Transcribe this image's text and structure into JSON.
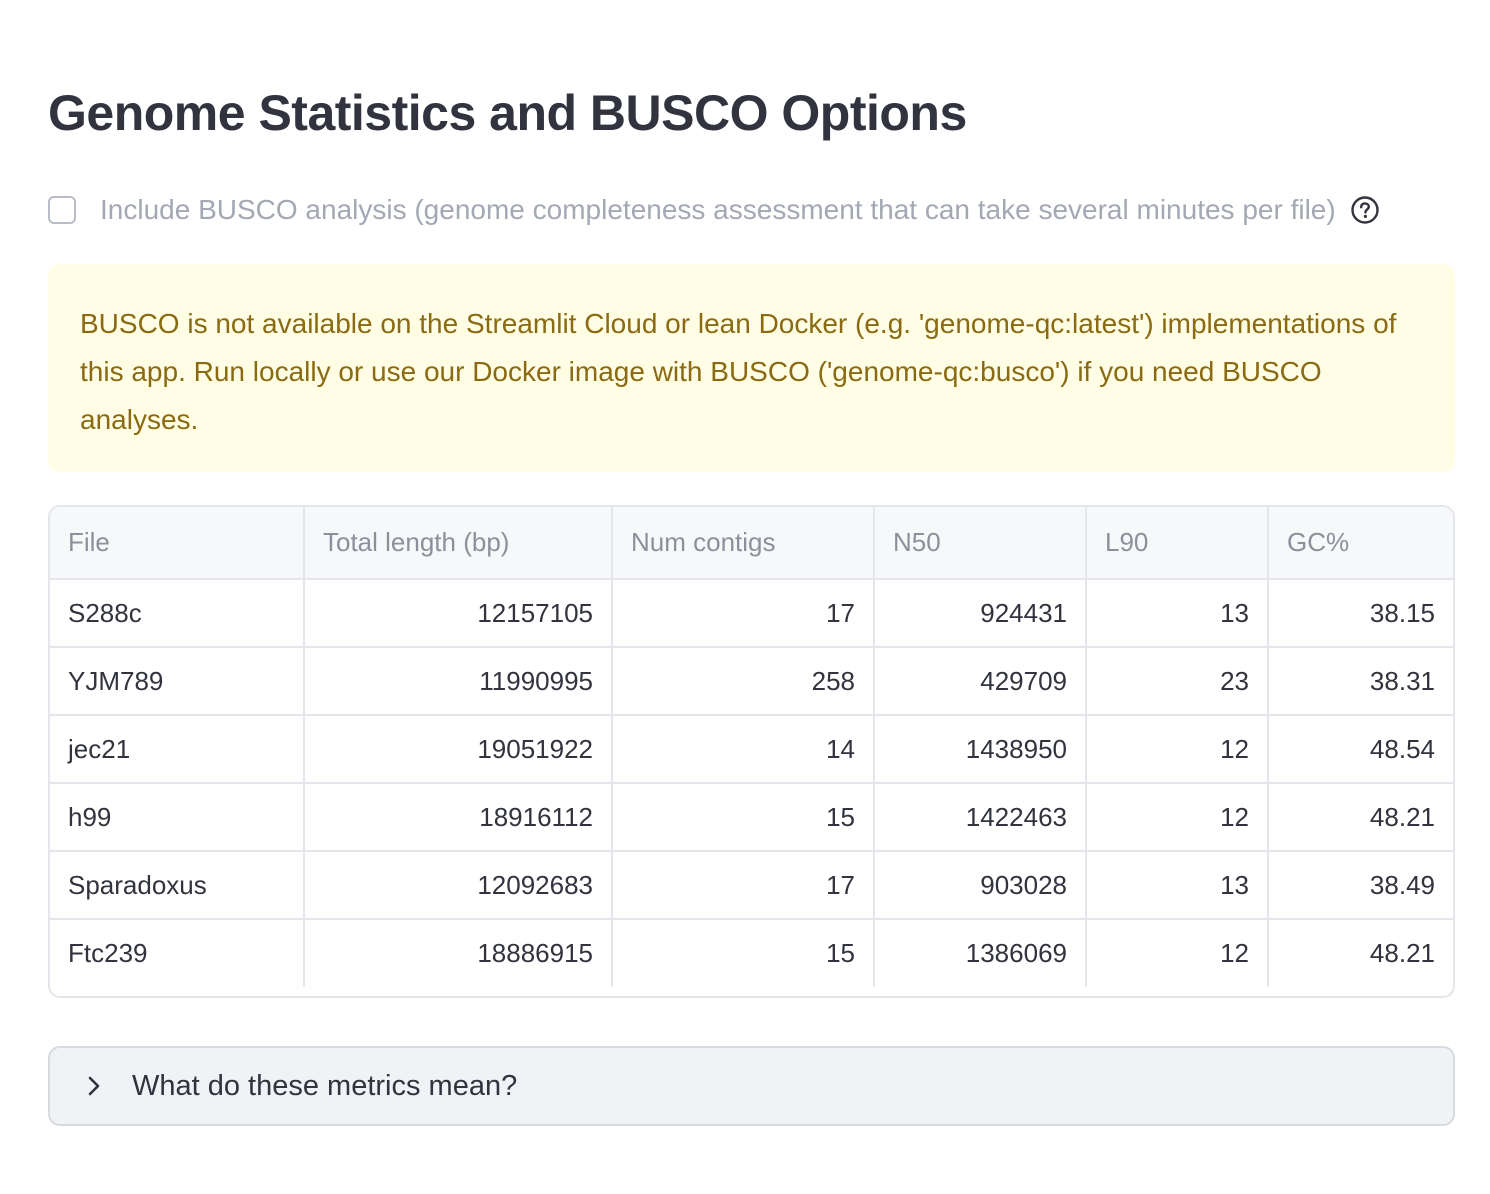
{
  "header": {
    "title": "Genome Statistics and BUSCO Options"
  },
  "busco_option": {
    "checked": false,
    "label": "Include BUSCO analysis (genome completeness assessment that can take several minutes per file)",
    "help_icon": "question-circle-icon"
  },
  "warning": {
    "text": "BUSCO is not available on the Streamlit Cloud or lean Docker (e.g. 'genome-qc:latest') implementations of this app. Run locally or use our Docker image with BUSCO ('genome-qc:busco') if you need BUSCO analyses.",
    "background": "#fffde4",
    "text_color": "#8a6a12"
  },
  "table": {
    "columns": [
      "File",
      "Total length (bp)",
      "Num contigs",
      "N50",
      "L90",
      "GC%"
    ],
    "rows": [
      [
        "S288c",
        "12157105",
        "17",
        "924431",
        "13",
        "38.15"
      ],
      [
        "YJM789",
        "11990995",
        "258",
        "429709",
        "23",
        "38.31"
      ],
      [
        "jec21",
        "19051922",
        "14",
        "1438950",
        "12",
        "48.54"
      ],
      [
        "h99",
        "18916112",
        "15",
        "1422463",
        "12",
        "48.21"
      ],
      [
        "Sparadoxus",
        "12092683",
        "17",
        "903028",
        "13",
        "38.49"
      ],
      [
        "Ftc239",
        "18886915",
        "15",
        "1386069",
        "12",
        "48.21"
      ]
    ]
  },
  "expander": {
    "label": "What do these metrics mean?",
    "icon": "chevron-right-icon",
    "expanded": false
  }
}
